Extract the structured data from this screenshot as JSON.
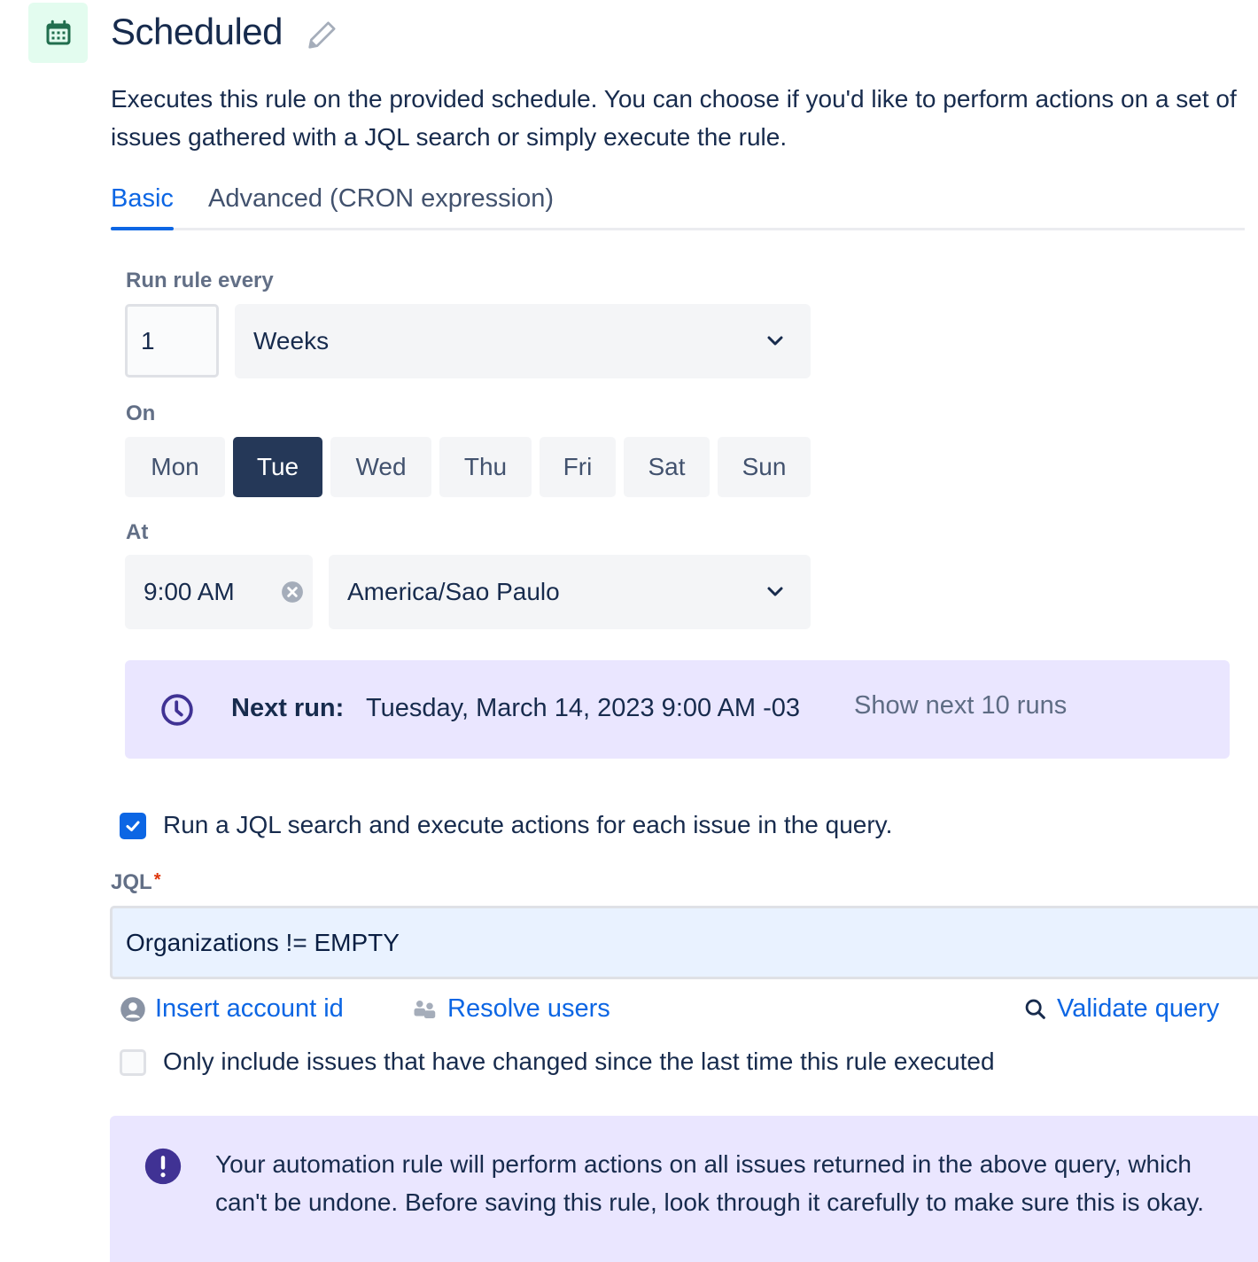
{
  "header": {
    "icon": "calendar-icon",
    "title": "Scheduled",
    "edit_icon": "pencil-icon",
    "description": "Executes this rule on the provided schedule. You can choose if you'd like to perform actions on a set of issues gathered with a JQL search or simply execute the rule."
  },
  "tabs": [
    {
      "label": "Basic",
      "active": true
    },
    {
      "label": "Advanced (CRON expression)",
      "active": false
    }
  ],
  "schedule": {
    "run_every_label": "Run rule every",
    "interval_value": "1",
    "interval_unit": "Weeks",
    "on_label": "On",
    "days": [
      {
        "label": "Mon",
        "selected": false
      },
      {
        "label": "Tue",
        "selected": true
      },
      {
        "label": "Wed",
        "selected": false
      },
      {
        "label": "Thu",
        "selected": false
      },
      {
        "label": "Fri",
        "selected": false
      },
      {
        "label": "Sat",
        "selected": false
      },
      {
        "label": "Sun",
        "selected": false
      }
    ],
    "at_label": "At",
    "time": "9:00 AM",
    "timezone": "America/Sao Paulo"
  },
  "next_run": {
    "icon": "clock-icon",
    "label": "Next run:",
    "value": "Tuesday, March 14, 2023 9:00 AM -03",
    "show_more": "Show next 10 runs"
  },
  "jql_section": {
    "run_jql_checked": true,
    "run_jql_label": "Run a JQL search and execute actions for each issue in the query.",
    "jql_label": "JQL",
    "required_mark": "*",
    "jql_value": "Organizations != EMPTY",
    "insert_account_id": "Insert account id",
    "resolve_users": "Resolve users",
    "validate_query": "Validate query",
    "only_changed_checked": false,
    "only_changed_label": "Only include issues that have changed since the last time this rule executed"
  },
  "warning": {
    "icon": "exclamation-icon",
    "text": "Your automation rule will perform actions on all issues returned in the above query, which can't be undone. Before saving this rule, look through it carefully to make sure this is okay."
  },
  "colors": {
    "accent": "#0C66E4",
    "selected_day": "#253858",
    "info_bg": "#EAE6FF",
    "discovery_icon": "#403294",
    "header_icon_bg": "#E3FCEF",
    "header_icon": "#216E4E"
  }
}
